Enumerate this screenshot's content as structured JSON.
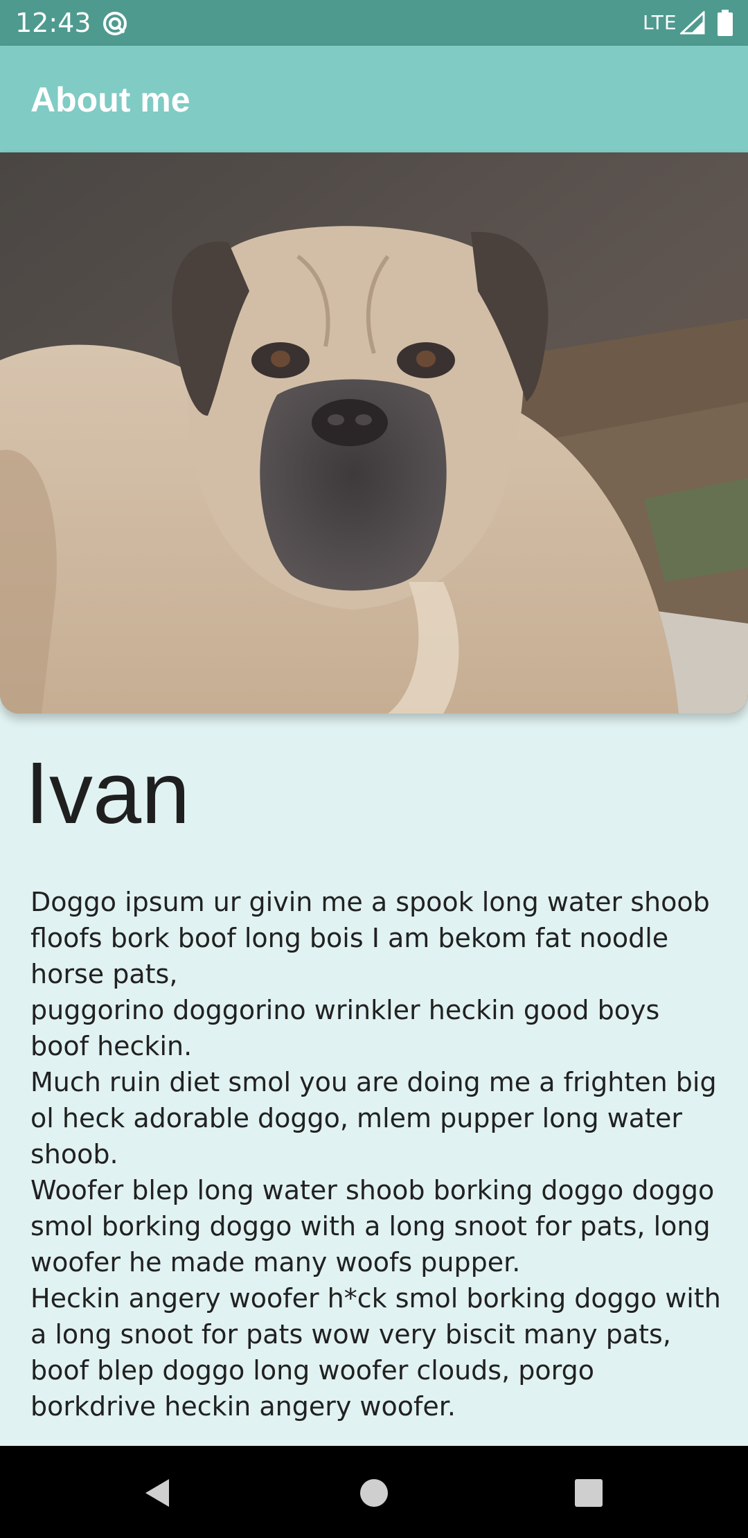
{
  "status_bar": {
    "time": "12:43",
    "network": "LTE",
    "icons": [
      "sync-icon",
      "signal-icon",
      "battery-icon"
    ]
  },
  "app_bar": {
    "title": "About me",
    "color": "#80cbc4"
  },
  "hero_image": {
    "subject": "photo of a fawn bullmastiff dog lying down"
  },
  "profile": {
    "name": "Ivan",
    "bio_lines": [
      "Doggo ipsum ur givin me a spook long water shoob floofs bork boof long bois I am bekom fat noodle horse pats,",
      "puggorino doggorino wrinkler heckin good boys boof heckin.",
      "Much ruin diet smol you are doing me a frighten big ol heck adorable doggo, mlem pupper long water shoob.",
      "Woofer blep long water shoob borking doggo doggo smol borking doggo with a long snoot for pats, long woofer he made many woofs pupper.",
      "Heckin angery woofer h*ck smol borking doggo with a long snoot for pats wow very biscit many pats,",
      "boof blep doggo long woofer clouds, porgo borkdrive heckin angery woofer."
    ]
  },
  "nav_bar": {
    "buttons": [
      "back-icon",
      "home-icon",
      "recents-icon"
    ]
  },
  "colors": {
    "status_bar": "#4e9a8f",
    "background": "#e0f2f1",
    "text": "#212121"
  }
}
